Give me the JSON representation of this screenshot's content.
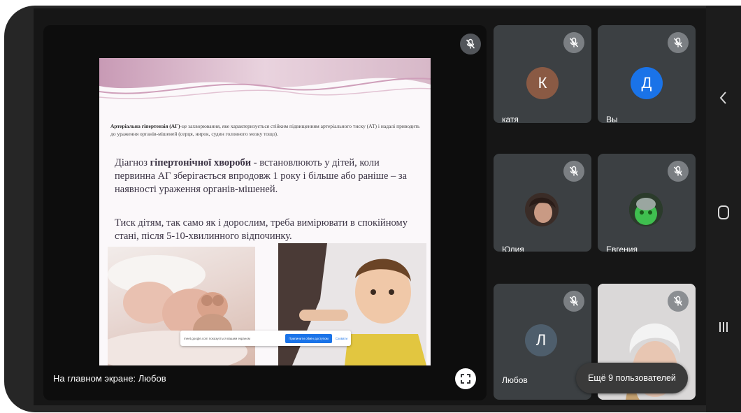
{
  "main": {
    "caption": "На главном экране: Любов"
  },
  "slide": {
    "definition_term": "Артеріальна гіпертензія (АГ)",
    "definition_rest": "-це захворювання, яке характеризується стійким підвищенням артеріального тиску (АТ) і надалі приводить до ураження органів-мішеней (серця, нирок, судин головного мозку тощо).",
    "p1_start": "Діагноз ",
    "p1_bold": "гіпертонічної хвороби",
    "p1_rest": " - встановлюють у дітей, коли первинна АГ зберігається впродовж  1 року і більше або раніше  – за наявності ураження органів-мішеней.",
    "p2": "Тиск дітям, так само як і дорослим, треба вимірювати в спокійному стані, після  5-10-хвилинного відпочинку."
  },
  "notice": {
    "text": "meet.google.com показується вашим екраном",
    "share_label": "Припинити обмін доступом",
    "close_label": "Сховати"
  },
  "participants": [
    {
      "name": "катя",
      "initial": "К",
      "color": "#8a5a44"
    },
    {
      "name": "Вы",
      "initial": "Д",
      "color": "#1a73e8"
    },
    {
      "name": "Юлия"
    },
    {
      "name": "Евгения"
    },
    {
      "name": "Любов",
      "initial": "Л",
      "color": "#4e5e6c"
    },
    {
      "name": ""
    }
  ],
  "more_users": "Ещё 9 пользователей",
  "icons": {
    "mic_off": "mic-off-icon",
    "fullscreen": "fullscreen-icon",
    "nav_back": "chevron-left-icon",
    "nav_home": "home-icon",
    "nav_recents": "recents-icon"
  }
}
